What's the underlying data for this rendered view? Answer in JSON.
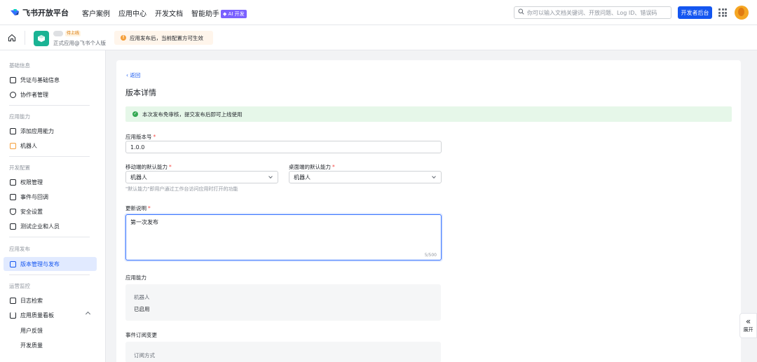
{
  "topbar": {
    "logo_text": "飞书开放平台",
    "nav": [
      "客户案例",
      "应用中心",
      "开发文档",
      "智能助手"
    ],
    "ai_badge": "◆ AI 开发",
    "search_placeholder": "你可以输入文档关键词、开放问题、Log ID、错误码",
    "dev_button": "开发者后台"
  },
  "appbar": {
    "status_badge": "待上线",
    "app_desc": "正式应用@飞书个人版",
    "notice": "应用发布后，当前配置方可生效"
  },
  "sidebar": {
    "groups": {
      "basic": "基础信息",
      "ability": "应用能力",
      "config": "开发配置",
      "release": "应用发布",
      "ops": "运营监控"
    },
    "items": {
      "credentials": "凭证与基础信息",
      "collaborators": "协作者管理",
      "add_ability": "添加应用能力",
      "bot": "机器人",
      "permissions": "权限管理",
      "events": "事件与回调",
      "security": "安全设置",
      "test_users": "测试企业和人员",
      "version": "版本管理与发布",
      "logs": "日志检索",
      "quality": "应用质量看板",
      "feedback": "用户反馈",
      "dev_quality": "开发质量"
    }
  },
  "main": {
    "back": "返回",
    "title": "版本详情",
    "success": "本次发布免审核，提交发布后即可上线使用",
    "version_label": "应用版本号",
    "version_value": "1.0.0",
    "mobile_label": "移动端的默认能力",
    "mobile_value": "机器人",
    "desktop_label": "桌面端的默认能力",
    "desktop_value": "机器人",
    "default_hint": "\"默认能力\"即用户通过工作台访问应用时打开的功能",
    "notes_label": "更新说明",
    "notes_value": "第一次发布",
    "notes_counter": "5/500",
    "ability_title": "应用能力",
    "ability_name": "机器人",
    "ability_status": "已启用",
    "events_title": "事件订阅变更",
    "events_method": "订阅方式"
  },
  "expand": "展开",
  "colors": {
    "primary": "#1456f0",
    "success_bg": "#e6f7e9",
    "warn_bg": "#fff5eb"
  }
}
